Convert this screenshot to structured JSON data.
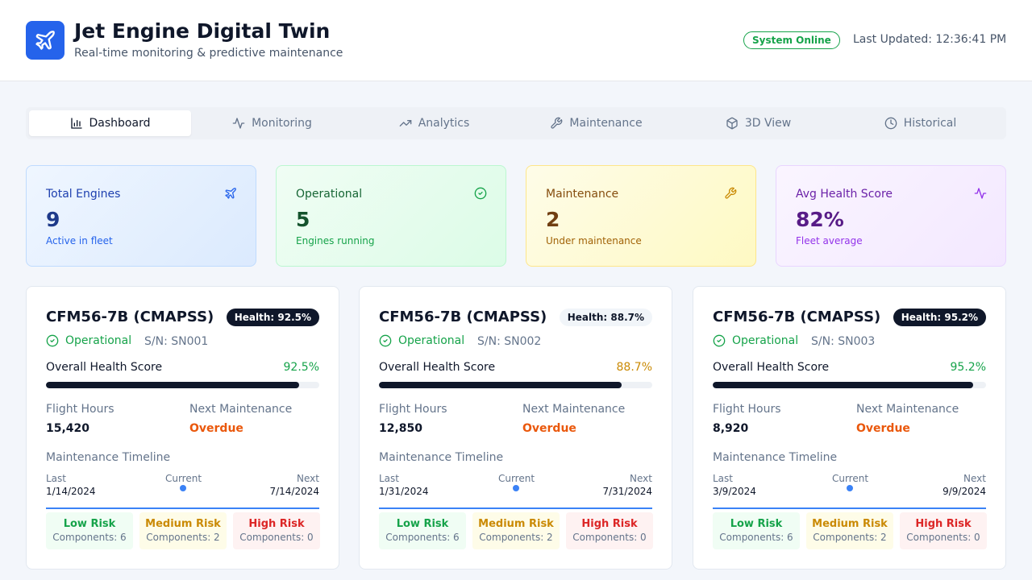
{
  "header": {
    "title": "Jet Engine Digital Twin",
    "subtitle": "Real-time monitoring & predictive maintenance",
    "status": "System Online",
    "last_updated": "Last Updated: 12:36:41 PM"
  },
  "tabs": [
    {
      "label": "Dashboard",
      "icon": "bar-chart-icon",
      "active": true
    },
    {
      "label": "Monitoring",
      "icon": "activity-icon",
      "active": false
    },
    {
      "label": "Analytics",
      "icon": "trending-up-icon",
      "active": false
    },
    {
      "label": "Maintenance",
      "icon": "wrench-icon",
      "active": false
    },
    {
      "label": "3D View",
      "icon": "cube-icon",
      "active": false
    },
    {
      "label": "Historical",
      "icon": "clock-icon",
      "active": false
    }
  ],
  "stats": [
    {
      "label": "Total Engines",
      "value": "9",
      "sub": "Active in fleet",
      "icon": "plane-icon",
      "color": "#2563eb"
    },
    {
      "label": "Operational",
      "value": "5",
      "sub": "Engines running",
      "icon": "check-circle-icon",
      "color": "#16a34a"
    },
    {
      "label": "Maintenance",
      "value": "2",
      "sub": "Under maintenance",
      "icon": "wrench-icon",
      "color": "#ca8a04"
    },
    {
      "label": "Avg Health Score",
      "value": "82%",
      "sub": "Fleet average",
      "icon": "activity-icon",
      "color": "#9333ea"
    }
  ],
  "engine_labels": {
    "overall_health": "Overall Health Score",
    "flight_hours": "Flight Hours",
    "next_maintenance": "Next Maintenance",
    "timeline": "Maintenance Timeline",
    "last": "Last",
    "current": "Current",
    "next": "Next"
  },
  "engines": [
    {
      "name": "CFM56-7B (CMAPSS)",
      "health_badge": "Health: 92.5%",
      "status": "Operational",
      "serial": "S/N: SN001",
      "health_score": "92.5%",
      "health_fraction": 0.925,
      "health_color": "#16a34a",
      "flight_hours": "15,420",
      "next_maintenance": "Overdue",
      "last_date": "1/14/2024",
      "next_date": "7/14/2024",
      "risks": [
        {
          "title": "Low Risk",
          "sub": "Components: 6"
        },
        {
          "title": "Medium Risk",
          "sub": "Components: 2"
        },
        {
          "title": "High Risk",
          "sub": "Components: 0"
        }
      ]
    },
    {
      "name": "CFM56-7B (CMAPSS)",
      "health_badge": "Health: 88.7%",
      "status": "Operational",
      "serial": "S/N: SN002",
      "health_score": "88.7%",
      "health_fraction": 0.887,
      "health_color": "#ca8a04",
      "flight_hours": "12,850",
      "next_maintenance": "Overdue",
      "last_date": "1/31/2024",
      "next_date": "7/31/2024",
      "risks": [
        {
          "title": "Low Risk",
          "sub": "Components: 6"
        },
        {
          "title": "Medium Risk",
          "sub": "Components: 2"
        },
        {
          "title": "High Risk",
          "sub": "Components: 0"
        }
      ]
    },
    {
      "name": "CFM56-7B (CMAPSS)",
      "health_badge": "Health: 95.2%",
      "status": "Operational",
      "serial": "S/N: SN003",
      "health_score": "95.2%",
      "health_fraction": 0.952,
      "health_color": "#16a34a",
      "flight_hours": "8,920",
      "next_maintenance": "Overdue",
      "last_date": "3/9/2024",
      "next_date": "9/9/2024",
      "risks": [
        {
          "title": "Low Risk",
          "sub": "Components: 6"
        },
        {
          "title": "Medium Risk",
          "sub": "Components: 2"
        },
        {
          "title": "High Risk",
          "sub": "Components: 0"
        }
      ]
    }
  ]
}
